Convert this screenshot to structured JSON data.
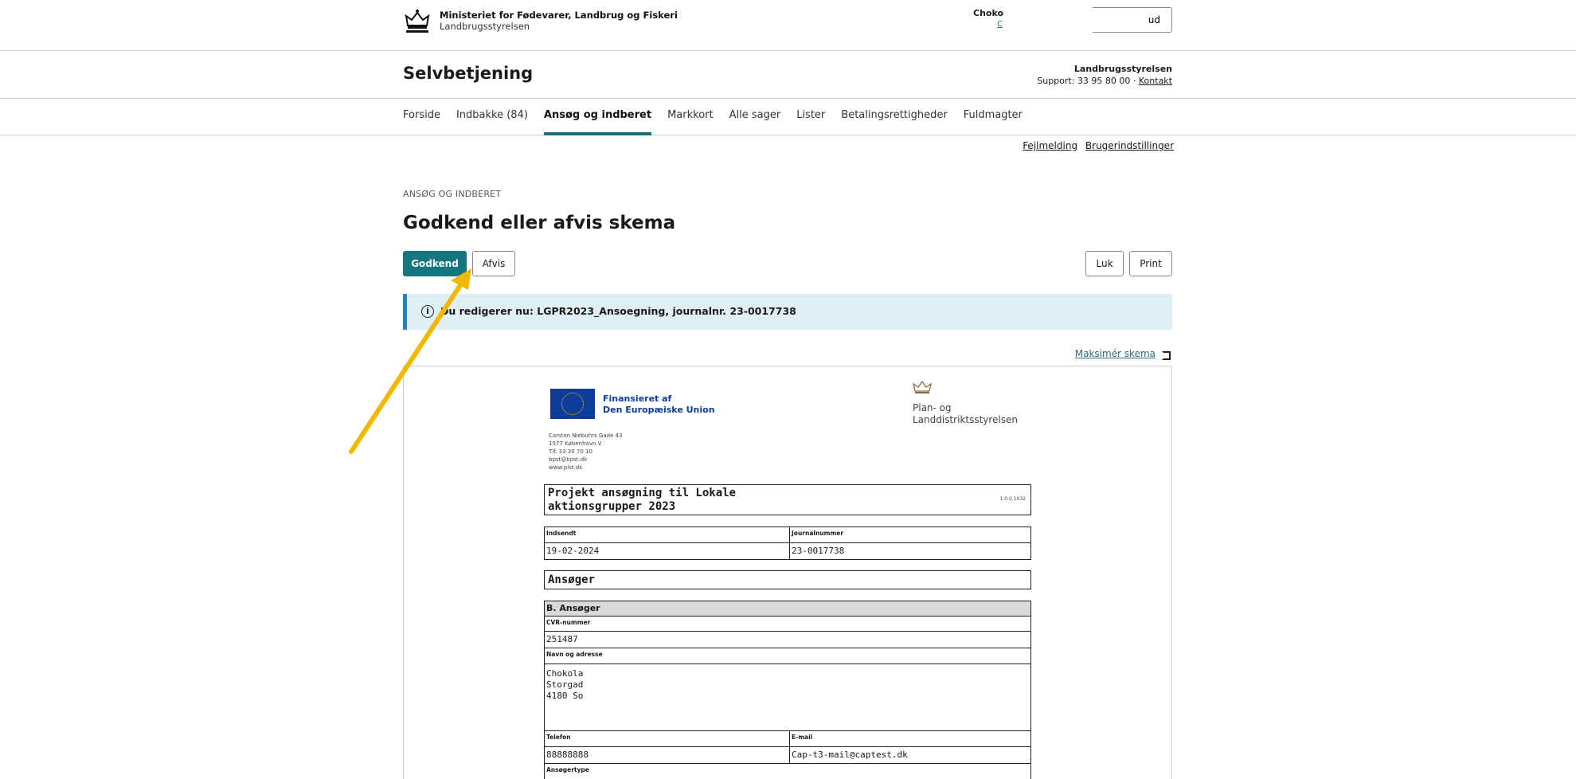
{
  "header": {
    "ministry": "Ministeriet for Fødevarer, Landbrug og Fiskeri",
    "agency": "Landbrugsstyrelsen",
    "user_name": "Choko",
    "logout_label": "ud"
  },
  "titlebar": {
    "site_title": "Selvbetjening",
    "org": "Landbrugsstyrelsen",
    "support_text": "Support: 33 95 80 00 · ",
    "contact_label": "Kontakt"
  },
  "nav": {
    "items": [
      {
        "label": "Forside"
      },
      {
        "label": "Indbakke (84)"
      },
      {
        "label": "Ansøg og indberet"
      },
      {
        "label": "Markkort"
      },
      {
        "label": "Alle sager"
      },
      {
        "label": "Lister"
      },
      {
        "label": "Betalingsrettigheder"
      },
      {
        "label": "Fuldmagter"
      }
    ],
    "active_index": 2
  },
  "util": {
    "error_report": "Fejlmelding",
    "user_settings": "Brugerindstillinger"
  },
  "page": {
    "breadcrumb": "ANSØG OG INDBERET",
    "title": "Godkend eller afvis skema",
    "approve_label": "Godkend",
    "reject_label": "Afvis",
    "close_label": "Luk",
    "print_label": "Print",
    "info_icon_glyph": "i",
    "info_text": "Du redigerer nu: LGPR2023_Ansoegning, journalnr. 23-0017738",
    "maximize_label": "Maksimér skema"
  },
  "document": {
    "eu_line1": "Finansieret af",
    "eu_line2": "Den Europæiske Union",
    "address": [
      "Carsten Niebuhrs Gade 43",
      "1577 København V",
      "Tlf. 33 30 70 10",
      "bpst@bpst.dk",
      "www.plst.dk"
    ],
    "agency_line1": "Plan- og",
    "agency_line2": "Landdistriktsstyrelsen",
    "form_title_line1": "Projekt ansøgning til Lokale",
    "form_title_line2": "aktionsgrupper 2023",
    "form_version": "1.0.0.1032",
    "submitted_label": "Indsendt",
    "submitted_value": "19-02-2024",
    "journal_label": "Journalnummer",
    "journal_value": "23-0017738",
    "applicant_heading": "Ansøger",
    "section_b": "B. Ansøger",
    "cvr_label": "CVR-nummer",
    "cvr_value": "251487",
    "name_address_label": "Navn og adresse",
    "name_lines": [
      "Chokola",
      "Storgad",
      "4180 So"
    ],
    "phone_label": "Telefon",
    "phone_value": "88888888",
    "email_label": "E-mail",
    "email_value": "Cap-t3-mail@captest.dk",
    "applicant_type_label": "Ansøgertype"
  },
  "colors": {
    "primary": "#167780",
    "info_bg": "#e0eff6",
    "info_border": "#2a7fb0",
    "arrow": "#f5b800",
    "eu_blue": "#0d3c9a"
  }
}
